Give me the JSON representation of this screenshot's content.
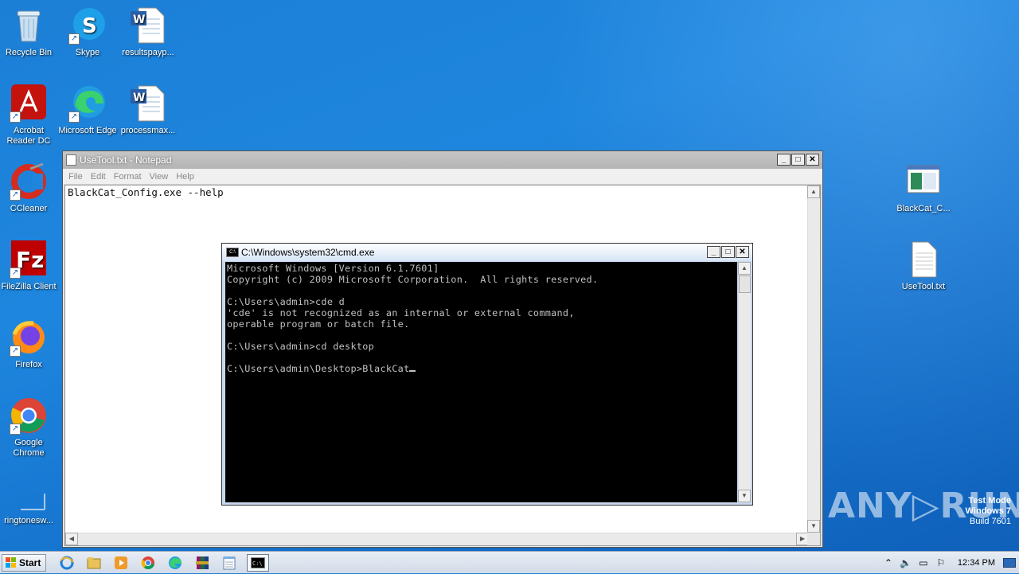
{
  "desktop": {
    "icons": [
      {
        "label": "Recycle Bin"
      },
      {
        "label": "Skype"
      },
      {
        "label": "resultspayp..."
      },
      {
        "label": "Acrobat Reader DC"
      },
      {
        "label": "Microsoft Edge"
      },
      {
        "label": "processmax..."
      },
      {
        "label": "CCleaner"
      },
      {
        "label": "FileZilla Client"
      },
      {
        "label": "Firefox"
      },
      {
        "label": "Google Chrome"
      },
      {
        "label": "ringtonesw..."
      },
      {
        "label": "BlackCat_C..."
      },
      {
        "label": "UseTool.txt"
      }
    ]
  },
  "notepad": {
    "title": "UseTool.txt - Notepad",
    "menu": [
      "File",
      "Edit",
      "Format",
      "View",
      "Help"
    ],
    "content": "BlackCat_Config.exe --help"
  },
  "cmd": {
    "title": "C:\\Windows\\system32\\cmd.exe",
    "lines": [
      "Microsoft Windows [Version 6.1.7601]",
      "Copyright (c) 2009 Microsoft Corporation.  All rights reserved.",
      "",
      "C:\\Users\\admin>cde d",
      "'cde' is not recognized as an internal or external command,",
      "operable program or batch file.",
      "",
      "C:\\Users\\admin>cd desktop",
      "",
      "C:\\Users\\admin\\Desktop>BlackCat"
    ]
  },
  "window_buttons": {
    "minimize": "_",
    "maximize": "□",
    "close": "✕"
  },
  "watermark": {
    "brand": "ANY▷RUN",
    "line1": "Test Mode",
    "line2": "Windows 7",
    "line3": "Build 7601"
  },
  "taskbar": {
    "start_label": "Start",
    "clock": "12:34 PM",
    "pinned": [
      "internet-explorer",
      "explorer",
      "media-player",
      "chrome",
      "edge",
      "winrar",
      "notepad",
      "cmd"
    ]
  }
}
